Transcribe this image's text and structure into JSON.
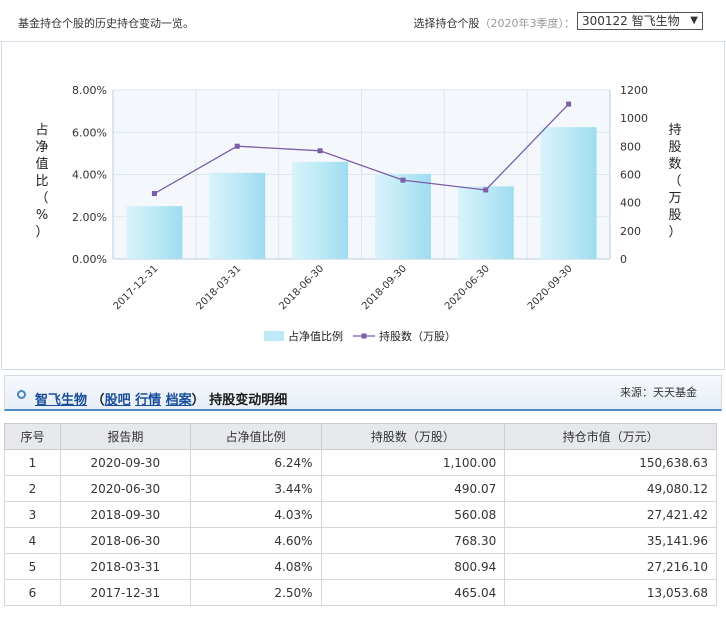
{
  "header": {
    "intro": "基金持仓个股的历史持仓变动一览。",
    "selector_label": "选择持仓个股",
    "selector_hint": "（2020年3季度）：",
    "selected_stock": "300122 智飞生物"
  },
  "chart_data": {
    "type": "bar",
    "categories": [
      "2017-12-31",
      "2018-03-31",
      "2018-06-30",
      "2018-09-30",
      "2020-06-30",
      "2020-09-30"
    ],
    "series": [
      {
        "name": "占净值比例",
        "type": "bar",
        "axis": "left",
        "values": [
          2.5,
          4.08,
          4.6,
          4.03,
          3.44,
          6.24
        ]
      },
      {
        "name": "持股数（万股）",
        "type": "line",
        "axis": "right",
        "values": [
          465.04,
          800.94,
          768.3,
          560.08,
          490.07,
          1100.0
        ]
      }
    ],
    "ylabel_left": "占净值比（%）",
    "ylabel_right": "持股数（万股）",
    "ylim_left": [
      0,
      8
    ],
    "ylim_right": [
      0,
      1200
    ],
    "yticks_left": [
      "0.00%",
      "2.00%",
      "4.00%",
      "6.00%",
      "8.00%"
    ],
    "yticks_right": [
      "0",
      "200",
      "400",
      "600",
      "800",
      "1000",
      "1200"
    ],
    "legend": "bottom",
    "colors": {
      "bar": "#bde9f6",
      "line": "#7b5ea7"
    }
  },
  "detail": {
    "stock_name": "智飞生物",
    "links": [
      "股吧",
      "行情",
      "档案"
    ],
    "open_paren": "（",
    "close_paren": "）",
    "suffix": "持股变动明细",
    "source": "来源：天天基金"
  },
  "table": {
    "headers": [
      "序号",
      "报告期",
      "占净值比例",
      "持股数（万股）",
      "持仓市值（万元）"
    ],
    "rows": [
      [
        "1",
        "2020-09-30",
        "6.24%",
        "1,100.00",
        "150,638.63"
      ],
      [
        "2",
        "2020-06-30",
        "3.44%",
        "490.07",
        "49,080.12"
      ],
      [
        "3",
        "2018-09-30",
        "4.03%",
        "560.08",
        "27,421.42"
      ],
      [
        "4",
        "2018-06-30",
        "4.60%",
        "768.30",
        "35,141.96"
      ],
      [
        "5",
        "2018-03-31",
        "4.08%",
        "800.94",
        "27,216.10"
      ],
      [
        "6",
        "2017-12-31",
        "2.50%",
        "465.04",
        "13,053.68"
      ]
    ]
  }
}
